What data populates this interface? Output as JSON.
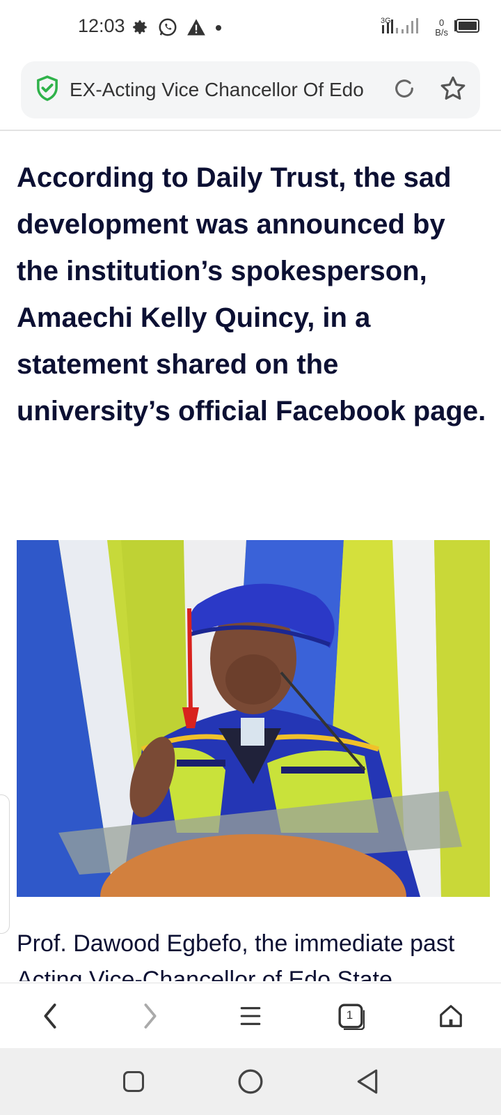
{
  "status_bar": {
    "time": "12:03",
    "net_speed_value": "0",
    "net_speed_unit": "B/s",
    "signal_label": "3G"
  },
  "url_bar": {
    "title": "EX-Acting Vice Chancellor Of Edo",
    "security": "shield-check-icon",
    "accent_color": "#2fb24a"
  },
  "article": {
    "lead_paragraph": "According to Daily Trust, the sad development was announced by the institution’s spokesperson, Amaechi Kelly Quincy, in a statement shared on the university’s official Facebook page.",
    "photo_alt": "Man in blue academic cap and gown speaking at a podium",
    "caption": "Prof. Dawood Egbefo, the immediate past Acting Vice-Chancellor of Edo State"
  },
  "toolbar": {
    "tab_count": "1"
  }
}
